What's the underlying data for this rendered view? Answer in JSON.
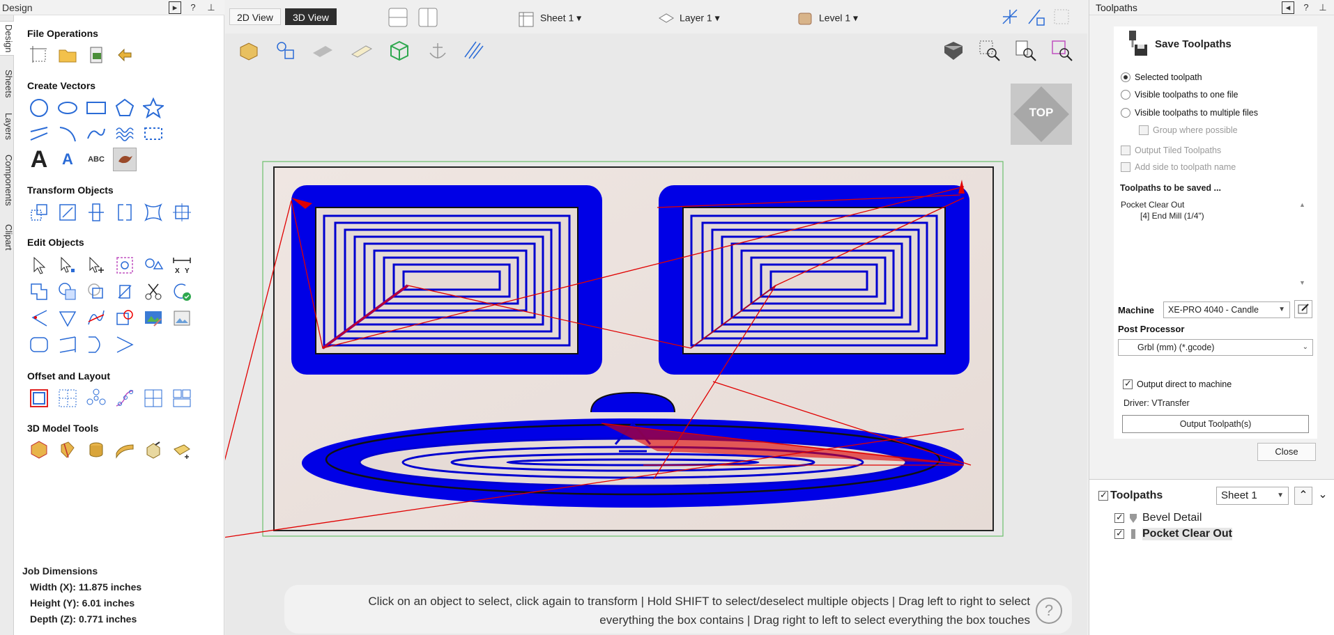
{
  "left_panel": {
    "title": "Design",
    "vtabs": [
      "Design",
      "Sheets",
      "Layers",
      "Components",
      "Clipart"
    ],
    "sections": {
      "file_operations": "File Operations",
      "create_vectors": "Create Vectors",
      "transform_objects": "Transform Objects",
      "edit_objects": "Edit Objects",
      "offset_layout": "Offset and Layout",
      "model_tools": "3D Model Tools"
    },
    "text_tool_glyphs": {
      "a_large": "A",
      "a_small": "A",
      "abc": "ABC"
    },
    "job_dimensions": {
      "title": "Job Dimensions",
      "width": "Width  (X): 11.875 inches",
      "height": "Height (Y): 6.01 inches",
      "depth": "Depth  (Z): 0.771 inches"
    }
  },
  "view_toolbar": {
    "view_2d": "2D View",
    "view_3d": "3D View",
    "sheet": "Sheet 1",
    "layer": "Layer 1",
    "level": "Level 1"
  },
  "viewport": {
    "cube_label": "TOP",
    "hint_line1": "Click on an object to select, click again to transform | Hold SHIFT to select/deselect multiple objects | Drag left to right to select",
    "hint_line2": "everything the box contains | Drag right to left to select everything the box touches",
    "help": "?"
  },
  "right_panel": {
    "title": "Toolpaths",
    "save_title": "Save Toolpaths",
    "options": {
      "selected": "Selected toolpath",
      "visible_one": "Visible toolpaths to one file",
      "visible_multi": "Visible toolpaths to multiple files",
      "group": "Group where possible",
      "tiled": "Output Tiled Toolpaths",
      "add_side": "Add side to toolpath name"
    },
    "to_be_saved_label": "Toolpaths to be saved ...",
    "to_be_saved": [
      "Pocket Clear Out",
      "[4] End Mill (1/4\")"
    ],
    "machine_label": "Machine",
    "machine_value": "XE-PRO 4040 - Candle",
    "post_label": "Post Processor",
    "post_value": "Grbl (mm) (*.gcode)",
    "output_direct": "Output direct to machine",
    "driver": "Driver: VTransfer",
    "output_button": "Output Toolpath(s)",
    "close_button": "Close",
    "list_title": "Toolpaths",
    "list_sheet": "Sheet 1",
    "items": [
      "Bevel Detail",
      "Pocket Clear Out"
    ]
  },
  "colors": {
    "toolpath_blue": "#0000e6",
    "rapid_red": "#e00000",
    "accent_blue": "#2a6bd6"
  }
}
